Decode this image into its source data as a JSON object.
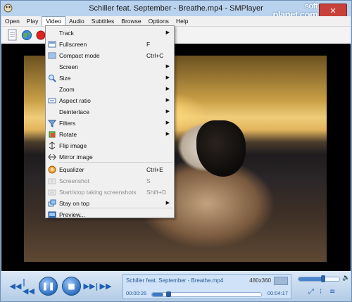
{
  "window": {
    "title": "Schiller feat. September - Breathe.mp4 - SMPlayer",
    "watermark_top": "soft",
    "watermark_main": "planet.com",
    "close_glyph": "✕"
  },
  "menubar": [
    "Open",
    "Play",
    "Video",
    "Audio",
    "Subtitles",
    "Browse",
    "Options",
    "Help"
  ],
  "video_menu": {
    "items": [
      {
        "label": "Track",
        "shortcut": "",
        "submenu": true,
        "disabled": false,
        "icon": ""
      },
      {
        "label": "Fullscreen",
        "shortcut": "F",
        "submenu": false,
        "disabled": false,
        "icon": "fullscreen-icon"
      },
      {
        "label": "Compact mode",
        "shortcut": "Ctrl+C",
        "submenu": false,
        "disabled": false,
        "icon": "compact-mode-icon"
      },
      {
        "label": "Screen",
        "shortcut": "",
        "submenu": true,
        "disabled": false,
        "icon": ""
      },
      {
        "label": "Size",
        "shortcut": "",
        "submenu": true,
        "disabled": false,
        "icon": "size-icon"
      },
      {
        "label": "Zoom",
        "shortcut": "",
        "submenu": true,
        "disabled": false,
        "icon": ""
      },
      {
        "label": "Aspect ratio",
        "shortcut": "",
        "submenu": true,
        "disabled": false,
        "icon": "aspect-ratio-icon"
      },
      {
        "label": "Deinterlace",
        "shortcut": "",
        "submenu": true,
        "disabled": false,
        "icon": ""
      },
      {
        "label": "Filters",
        "shortcut": "",
        "submenu": true,
        "disabled": false,
        "icon": "filters-icon"
      },
      {
        "label": "Rotate",
        "shortcut": "",
        "submenu": true,
        "disabled": false,
        "icon": "rotate-icon"
      },
      {
        "label": "Flip image",
        "shortcut": "",
        "submenu": false,
        "disabled": false,
        "icon": "flip-image-icon"
      },
      {
        "label": "Mirror image",
        "shortcut": "",
        "submenu": false,
        "disabled": false,
        "icon": "mirror-image-icon"
      },
      {
        "label": "Equalizer",
        "shortcut": "Ctrl+E",
        "submenu": false,
        "disabled": false,
        "icon": "equalizer-icon"
      },
      {
        "label": "Screenshot",
        "shortcut": "S",
        "submenu": false,
        "disabled": true,
        "icon": "screenshot-icon"
      },
      {
        "label": "Start/stop taking screenshots",
        "shortcut": "Shift+D",
        "submenu": false,
        "disabled": true,
        "icon": "multi-screenshot-icon"
      },
      {
        "label": "Stay on top",
        "shortcut": "",
        "submenu": true,
        "disabled": false,
        "icon": "stay-on-top-icon"
      },
      {
        "label": "Preview...",
        "shortcut": "",
        "submenu": false,
        "disabled": false,
        "icon": "preview-icon"
      }
    ]
  },
  "player": {
    "filename": "Schiller feat. September - Breathe.mp4",
    "resolution": "480x360",
    "time_current": "00:00:26",
    "time_total": "00:04:17",
    "progress_fraction": 0.101,
    "volume_fraction": 0.6
  },
  "controls": {
    "rewind": "◀◀",
    "prev": "|◀◀",
    "play": "❚❚",
    "stop": "■",
    "next": "▶▶|",
    "forward": "▶▶",
    "fullscreen": "⤢",
    "playlist": "≡"
  },
  "colors": {
    "accent": "#1e5fb3",
    "menu_bg": "#f0f0f0",
    "close_button": "#c7413a"
  }
}
